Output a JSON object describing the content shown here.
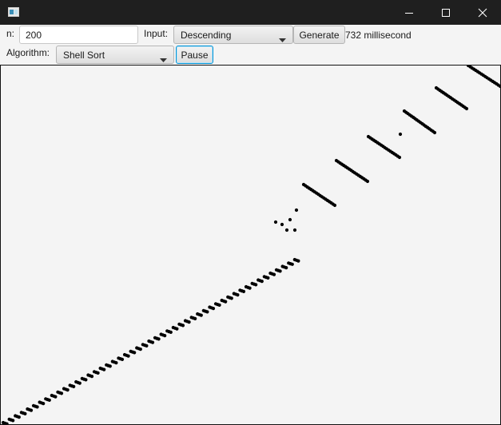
{
  "window": {
    "minimize_icon": "minimize-icon",
    "maximize_icon": "maximize-icon",
    "close_icon": "close-icon",
    "title_bar_color": "#1f1f1f"
  },
  "controls": {
    "n_label": "n:",
    "n_value": "200",
    "input_label": "Input:",
    "input_selected": "Descending",
    "generate_label": "Generate",
    "elapsed_text": "732 millisecond",
    "algorithm_label": "Algorithm:",
    "algorithm_selected": "Shell Sort",
    "pause_label": "Pause"
  },
  "visualization": {
    "description_type": "scatter",
    "point_color": "#000000",
    "background": "#f4f4f4"
  }
}
